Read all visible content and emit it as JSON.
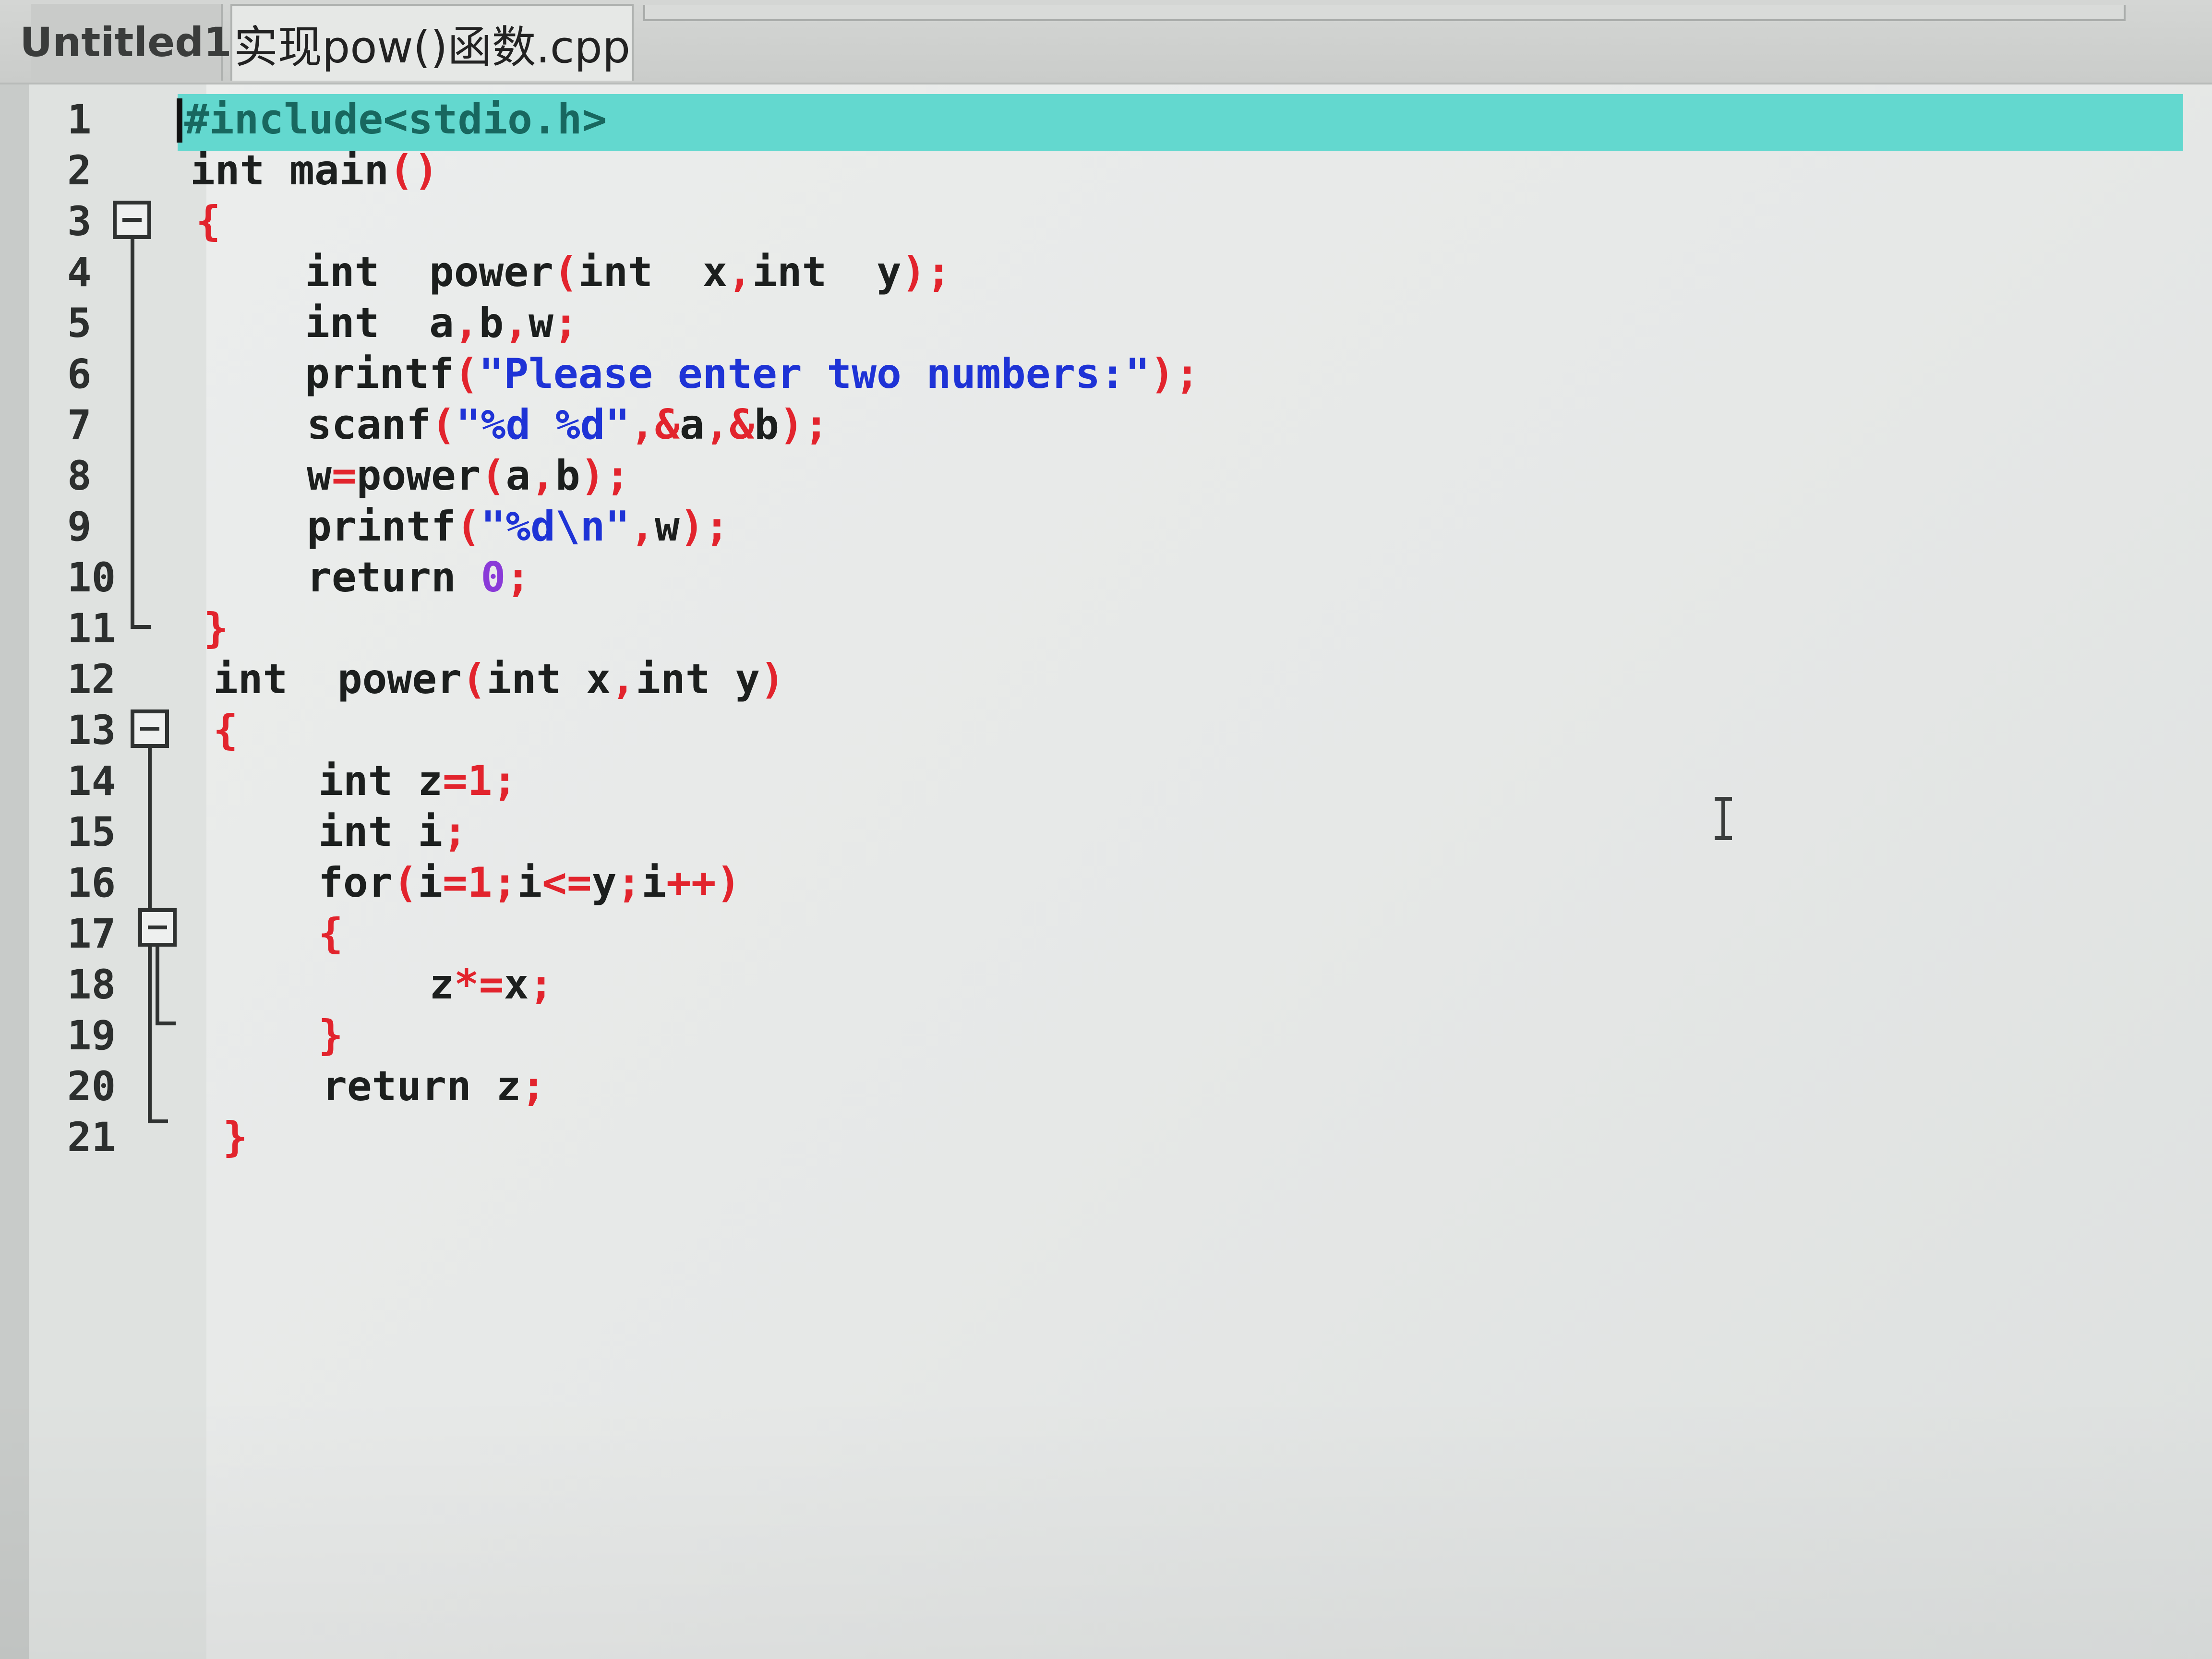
{
  "tabs": [
    {
      "label": "Untitled1",
      "active": false
    },
    {
      "label": "实现pow()函数.cpp",
      "active": true
    }
  ],
  "editor": {
    "line_numbers": [
      "1",
      "2",
      "3",
      "4",
      "5",
      "6",
      "7",
      "8",
      "9",
      "10",
      "11",
      "12",
      "13",
      "14",
      "15",
      "16",
      "17",
      "18",
      "19",
      "20",
      "21"
    ],
    "code": [
      "#include<stdio.h>",
      "int main()",
      "{",
      "    int  power(int  x,int  y);",
      "    int  a,b,w;",
      "    printf(\"Please enter two numbers:\");",
      "    scanf(\"%d %d\",&a,&b);",
      "    w=power(a,b);",
      "    printf(\"%d\\n\",w);",
      "    return 0;",
      "}",
      "int  power(int x,int y)",
      "{",
      "    int z=1;",
      "    int i;",
      "    for(i=1;i<=y;i++)",
      "    {",
      "        z*=x;",
      "    }",
      "    return z;",
      "}"
    ],
    "current_line": 1,
    "fold_markers": [
      3,
      13,
      17
    ]
  },
  "colors": {
    "current_line_bg": "#63d8cf",
    "punctuation": "#e2242d",
    "string": "#1e33d6",
    "number": "#8a3ad8",
    "text": "#1c1f1e"
  }
}
